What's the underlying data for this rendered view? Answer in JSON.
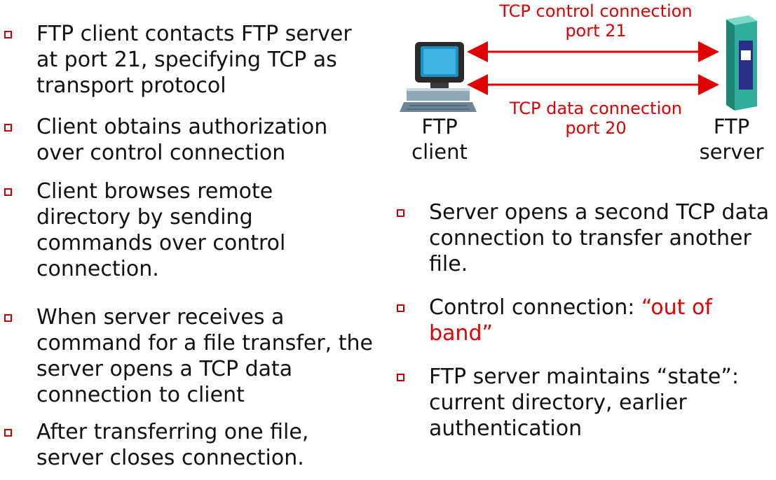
{
  "left_bullets": [
    "FTP client contacts FTP server at port 21, specifying TCP as transport protocol",
    "Client obtains authorization over control connection",
    "Client browses remote directory by sending commands over control connection.",
    "When server receives a command for a file transfer, the server opens a TCP data connection to client",
    "After transferring one file, server closes connection."
  ],
  "diagram": {
    "control_label_line1": "TCP control connection",
    "control_label_line2": "port 21",
    "data_label_line1": "TCP data connection",
    "data_label_line2": "port 20",
    "client_label_line1": "FTP",
    "client_label_line2": "client",
    "server_label_line1": "FTP",
    "server_label_line2": "server"
  },
  "right_bullets": {
    "b1": "Server opens a second TCP data connection to transfer another file.",
    "b2_prefix": "Control connection: ",
    "b2_highlight": "“out of band”",
    "b3": "FTP server maintains “state”: current directory, earlier authentication"
  },
  "colors": {
    "accent": "#e00000",
    "bullet": "#c00000"
  }
}
